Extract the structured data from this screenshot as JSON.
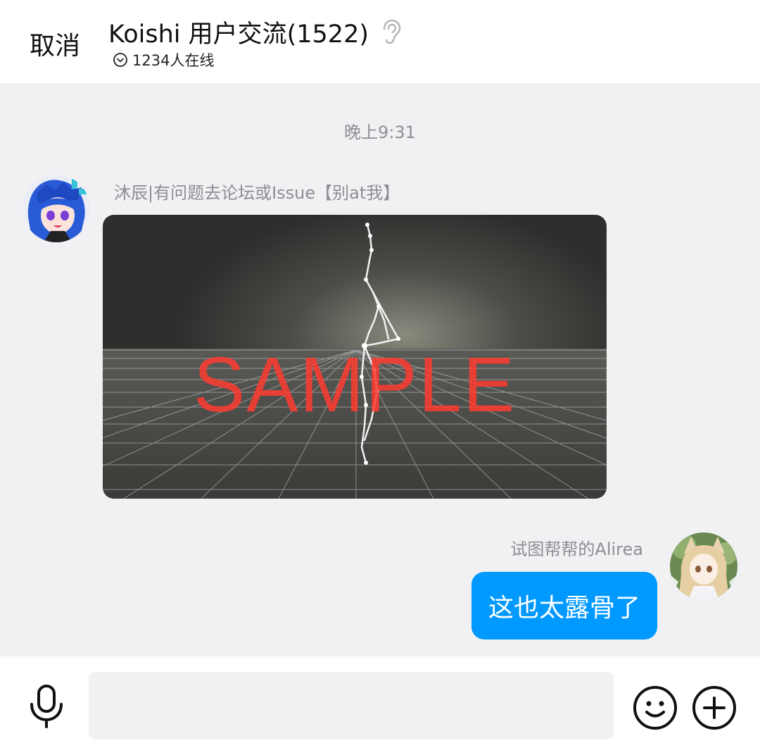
{
  "header": {
    "cancel_label": "取消",
    "title": "Koishi 用户交流(1522)",
    "online_text": "1234人在线"
  },
  "chat": {
    "timestamp": "晚上9:31",
    "messages": [
      {
        "sender": "沐辰|有问题去论坛或Issue【别at我】",
        "type": "image",
        "watermark": "SAMPLE"
      },
      {
        "sender": "试图帮帮的Alirea",
        "type": "text",
        "text": "这也太露骨了"
      }
    ]
  },
  "input_bar": {
    "placeholder": ""
  },
  "colors": {
    "bubble": "#0099ff",
    "background": "#f1f1f3",
    "watermark": "#ff3b30"
  },
  "icons": [
    "ear-icon",
    "chevron-down-circle-icon",
    "mic-icon",
    "emoji-icon",
    "plus-icon"
  ]
}
